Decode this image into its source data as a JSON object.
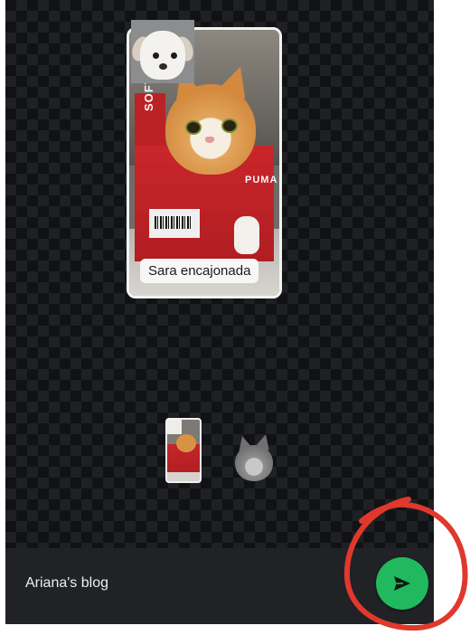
{
  "sticker": {
    "caption": "Sara encajonada",
    "box_brand_vertical": "SOFTFOAM",
    "box_brand": "PUMA"
  },
  "tray": {
    "items": [
      "sticker-thumbnail",
      "cat-sticker-thumbnail"
    ]
  },
  "bottom_bar": {
    "recipient": "Ariana's blog",
    "send_icon": "send-icon"
  },
  "colors": {
    "send_button": "#22b85e",
    "annotation": "#e0382d",
    "background": "#111214"
  }
}
